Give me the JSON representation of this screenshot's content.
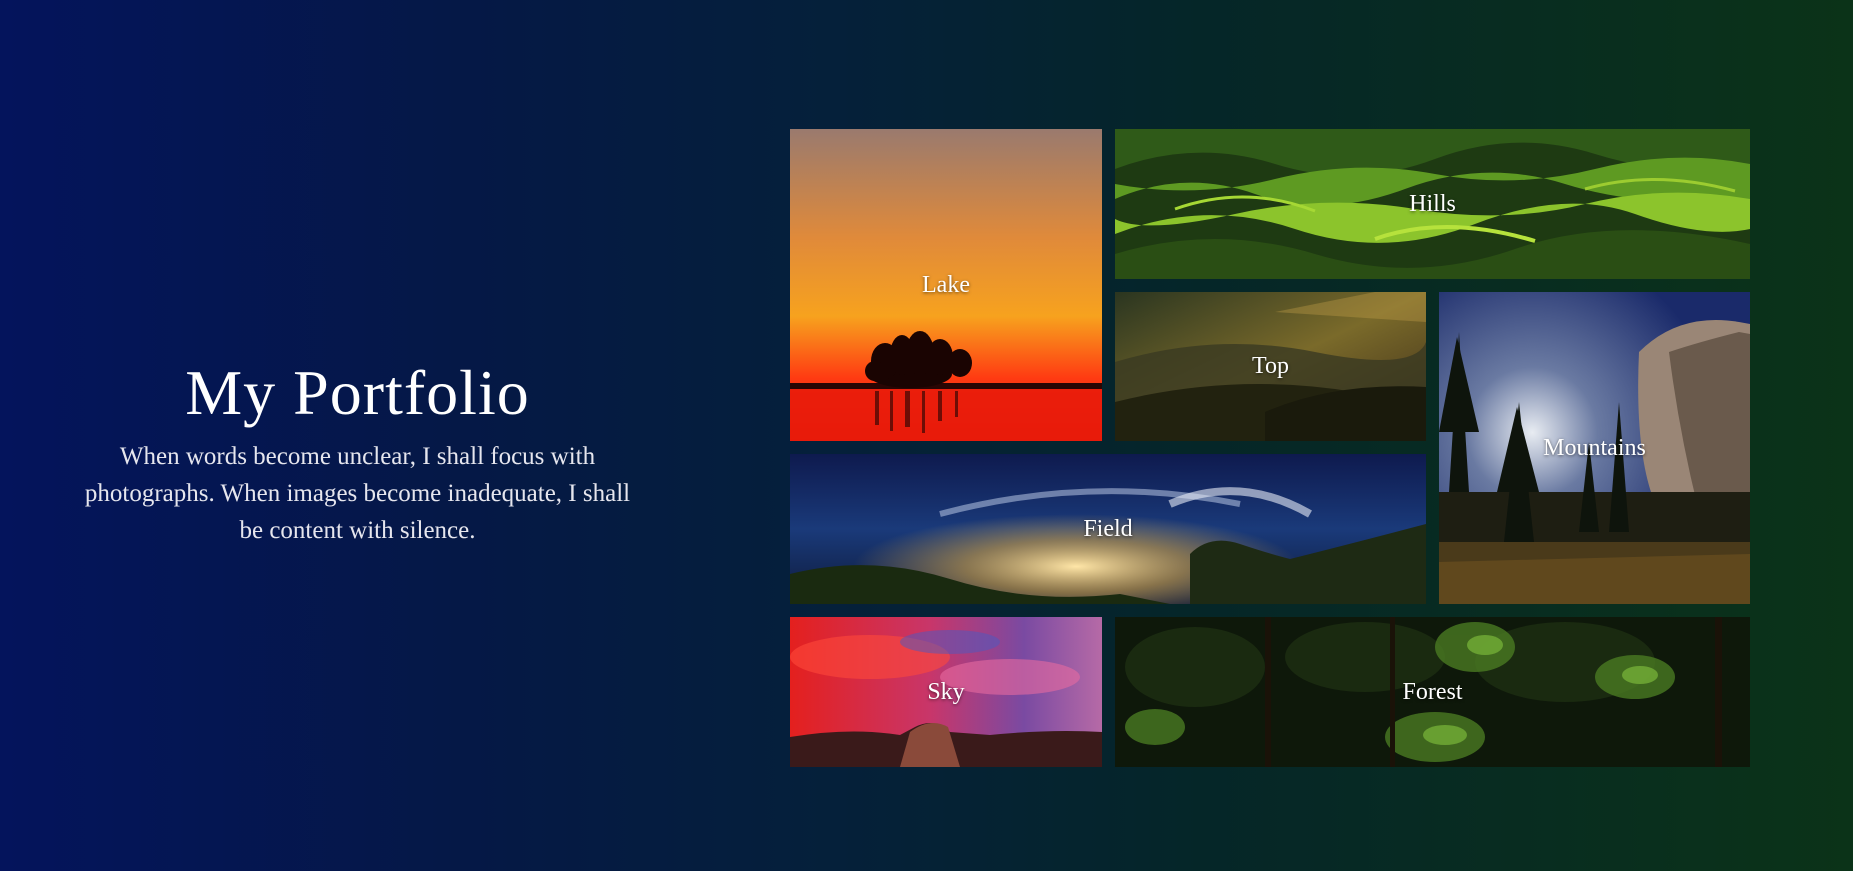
{
  "intro": {
    "title": "My Portfolio",
    "quote": "When words become unclear, I shall focus with photographs. When images become inadequate, I shall be content with silence."
  },
  "gallery": {
    "tiles": [
      {
        "label": "Lake"
      },
      {
        "label": "Hills"
      },
      {
        "label": "Top"
      },
      {
        "label": "Mountains"
      },
      {
        "label": "Field"
      },
      {
        "label": "Sky"
      },
      {
        "label": "Forest"
      }
    ]
  },
  "colors": {
    "background_start": "#04145c",
    "background_end": "#0b3318",
    "text": "#ffffff"
  }
}
